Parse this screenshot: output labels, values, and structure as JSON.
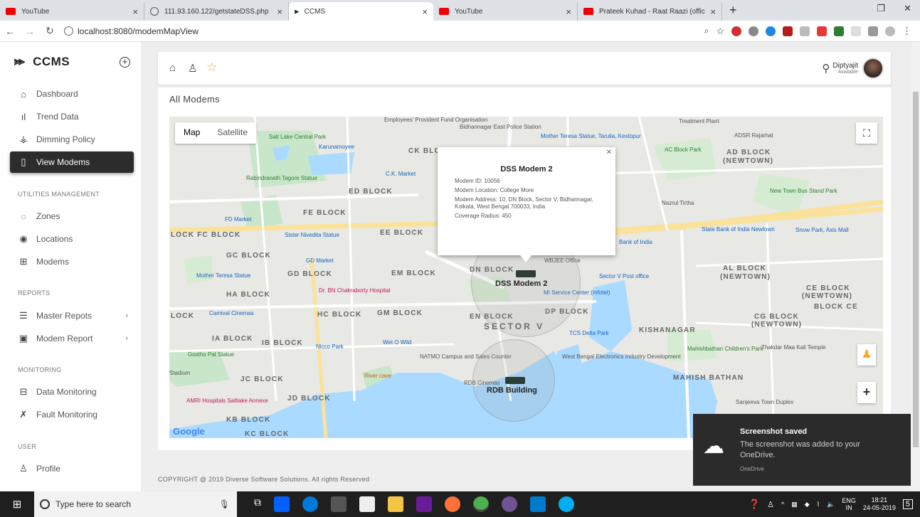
{
  "browser": {
    "tabs": [
      {
        "title": "YouTube",
        "icon": "youtube-icon"
      },
      {
        "title": "111.93.160.122/getstateDSS.php",
        "icon": "globe-icon"
      },
      {
        "title": "CCMS",
        "icon": "ccms-icon"
      },
      {
        "title": "YouTube",
        "icon": "youtube-icon"
      },
      {
        "title": "Prateek Kuhad - Raat Raazi (offic",
        "icon": "youtube-icon"
      }
    ],
    "url": "localhost:8080/modemMapView"
  },
  "sidebar": {
    "brand": "CCMS",
    "items": [
      {
        "label": "Dashboard",
        "icon": "home-icon"
      },
      {
        "label": "Trend Data",
        "icon": "bar-chart-icon"
      },
      {
        "label": "Dimming Policy",
        "icon": "dimming-icon"
      },
      {
        "label": "View Modems",
        "icon": "map-icon"
      }
    ],
    "section_utilities": "UTILITIES MANAGEMENT",
    "utilities": [
      {
        "label": "Zones",
        "icon": "zone-icon"
      },
      {
        "label": "Locations",
        "icon": "location-pin-icon"
      },
      {
        "label": "Modems",
        "icon": "chip-icon"
      }
    ],
    "section_reports": "REPORTS",
    "reports": [
      {
        "label": "Master Repots",
        "icon": "list-icon"
      },
      {
        "label": "Modem Report",
        "icon": "report-icon"
      }
    ],
    "section_monitoring": "MONITORING",
    "monitoring": [
      {
        "label": "Data Monitoring",
        "icon": "data-icon"
      },
      {
        "label": "Fault Monitoring",
        "icon": "fault-icon"
      }
    ],
    "section_user": "USER",
    "user": [
      {
        "label": "Profile",
        "icon": "user-icon"
      }
    ]
  },
  "topbar": {
    "user_name": "Diptyajit",
    "user_status": "Available"
  },
  "card": {
    "title": "All Modems"
  },
  "map": {
    "type_map": "Map",
    "type_satellite": "Satellite",
    "google": "Google",
    "infowindow": {
      "title": "DSS Modem 2",
      "modem_id": "Modem ID: 10056",
      "location": "Modem Location: College More",
      "address": "Modem Address: 10, DN Block, Sector V, Bidhannagar, Kolkata, West Bengal 700033, India",
      "radius": "Coverage Radius: 450"
    },
    "markers": [
      {
        "label": "DSS Modem 2"
      },
      {
        "label": "RDB Building"
      }
    ],
    "areas": [
      "ED BLOCK",
      "FE BLOCK",
      "EE BLOCK",
      "LOCK FC BLOCK",
      "GC BLOCK",
      "GD BLOCK",
      "HA BLOCK",
      "HC BLOCK",
      "GM BLOCK",
      "EM BLOCK",
      "DN BLOCK",
      "EN BLOCK",
      "DP BLOCK",
      "SECTOR V",
      "IA BLOCK",
      "IB BLOCK",
      "JC BLOCK",
      "JD BLOCK",
      "KB BLOCK",
      "KC BLOCK",
      "AD BLOCK",
      "(NEWTOWN)",
      "AL BLOCK",
      "(NEWTOWN)",
      "CE BLOCK",
      "(NEWTOWN)",
      "BLOCK CE",
      "CG BLOCK",
      "(NEWTOWN)",
      "KISHANAGAR",
      "MAHISH BATHAN",
      "CK BLOC",
      "LOCK"
    ],
    "pois": [
      "Salt Lake Central Park",
      "Karunamoyee",
      "Rabindranath Tagore Statue",
      "FD Market",
      "Sister Nivedita Statue",
      "GD Market",
      "Mother Teresa Statue",
      "Dr. BN Chakraborty Hospital",
      "Camival Cinemas",
      "Wet O Wild",
      "Nicco Park",
      "NATMO Campus and Sales Counter",
      "River cave",
      "RDB Cinemas",
      "AMRI Hospitals Saltlake Annexe",
      "Gostho Pal Statue",
      "Stadium",
      "Bidhannagar East Police Station",
      "Mother Teresa Statue, Tarulia, Kestopur",
      "AC Block Park",
      "ADSR Rajarhat",
      "Nazrul Tirtha",
      "State Bank of India Newtown",
      "Snow Park, Axis Mall",
      "New Town Bus Stand Park",
      "Sector V Post office",
      "WBJEE Office",
      "MI Service Center (Infotel)",
      "TCS Delta Park",
      "West Bengal Electronics Industry Development",
      "Mahishbathan Children's Park",
      "Thakdar Maa Kali Temple",
      "Sanjeeva Town Duplex",
      "Employees' Provident Fund Organisation",
      "C.K. Market",
      "Treatment Plant",
      "Bank of India"
    ]
  },
  "footer": "COPYRIGHT @ 2019 Diverse Software Solutions. All rights Reserved",
  "toast": {
    "title": "Screenshot saved",
    "message": "The screenshot was added to your OneDrive.",
    "source": "OneDrive"
  },
  "taskbar": {
    "search_placeholder": "Type here to search",
    "lang1": "ENG",
    "lang2": "IN",
    "time": "18:21",
    "date": "24-05-2019",
    "notif_count": "5"
  }
}
